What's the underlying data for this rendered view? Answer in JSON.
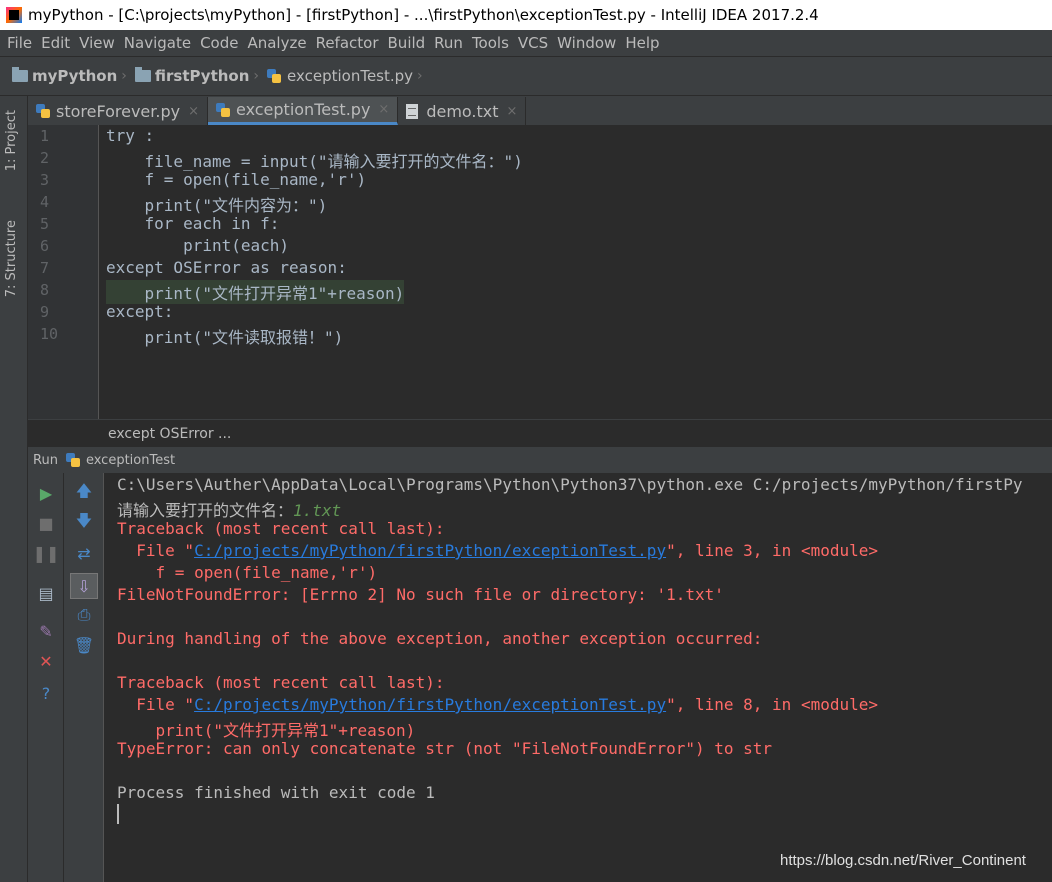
{
  "window": {
    "title": "myPython - [C:\\projects\\myPython] - [firstPython] - ...\\firstPython\\exceptionTest.py - IntelliJ IDEA 2017.2.4"
  },
  "menu": [
    "File",
    "Edit",
    "View",
    "Navigate",
    "Code",
    "Analyze",
    "Refactor",
    "Build",
    "Run",
    "Tools",
    "VCS",
    "Window",
    "Help"
  ],
  "breadcrumbs": [
    "myPython",
    "firstPython",
    "exceptionTest.py"
  ],
  "sidebar": {
    "project_tab": "1: Project",
    "structure_tab": "7: Structure"
  },
  "tabs": [
    {
      "label": "storeForever.py",
      "close": "×"
    },
    {
      "label": "exceptionTest.py",
      "close": "×"
    },
    {
      "label": "demo.txt",
      "close": "×"
    }
  ],
  "editor": {
    "line_numbers": [
      "1",
      "2",
      "3",
      "4",
      "5",
      "6",
      "7",
      "8",
      "9",
      "10"
    ],
    "lines": [
      "try :",
      "    file_name = input(\"请输入要打开的文件名：\")",
      "    f = open(file_name,'r')",
      "    print(\"文件内容为：\")",
      "    for each in f:",
      "        print(each)",
      "except OSError as reason:",
      "    print(\"文件打开异常1\"+reason)",
      "except:",
      "    print(\"文件读取报错！\")"
    ],
    "breadcrumb": "except OSError ..."
  },
  "run": {
    "label": "Run",
    "config": "exceptionTest"
  },
  "console": {
    "cmd": "C:\\Users\\Auther\\AppData\\Local\\Programs\\Python\\Python37\\python.exe C:/projects/myPython/firstPy",
    "prompt": "请输入要打开的文件名：",
    "user_input": "1.txt",
    "tb1_header": "Traceback (most recent call last):",
    "tb1_file_pre": "  File \"",
    "tb1_file_link": "C:/projects/myPython/firstPython/exceptionTest.py",
    "tb1_file_post": "\", line 3, in <module>",
    "tb1_code": "    f = open(file_name,'r')",
    "tb1_error": "FileNotFoundError: [Errno 2] No such file or directory: '1.txt'",
    "during": "During handling of the above exception, another exception occurred:",
    "tb2_header": "Traceback (most recent call last):",
    "tb2_file_pre": "  File \"",
    "tb2_file_link": "C:/projects/myPython/firstPython/exceptionTest.py",
    "tb2_file_post": "\", line 8, in <module>",
    "tb2_code": "    print(\"文件打开异常1\"+reason)",
    "tb2_error": "TypeError: can only concatenate str (not \"FileNotFoundError\") to str",
    "finished": "Process finished with exit code 1"
  },
  "watermark": "https://blog.csdn.net/River_Continent"
}
